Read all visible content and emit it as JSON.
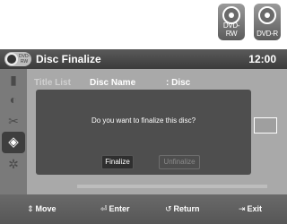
{
  "badges": [
    {
      "label": "DVD-RW"
    },
    {
      "label": "DVD-R"
    }
  ],
  "titlebar": {
    "icon_text": "DVD-RW",
    "title": "Disc Finalize",
    "time": "12:00"
  },
  "sidebar": {
    "items": [
      {
        "icon": "film-icon"
      },
      {
        "icon": "disc-add-icon"
      },
      {
        "icon": "scissors-icon"
      },
      {
        "icon": "disc-settings-icon",
        "selected": true
      },
      {
        "icon": "gear-icon"
      }
    ]
  },
  "background": {
    "title_list": "Title List",
    "disc_name": "Disc Name",
    "disc_prefix": ": Disc"
  },
  "dialog": {
    "message": "Do you want to finalize this disc?",
    "finalize_label": "Finalize",
    "unfinalize_label": "Unfinalize"
  },
  "bottombar": {
    "move_icon": "⇕",
    "move": "Move",
    "enter_icon": "⏎",
    "enter": "Enter",
    "return_icon": "↺",
    "return": "Return",
    "exit_icon": "⇥",
    "exit": "Exit"
  }
}
